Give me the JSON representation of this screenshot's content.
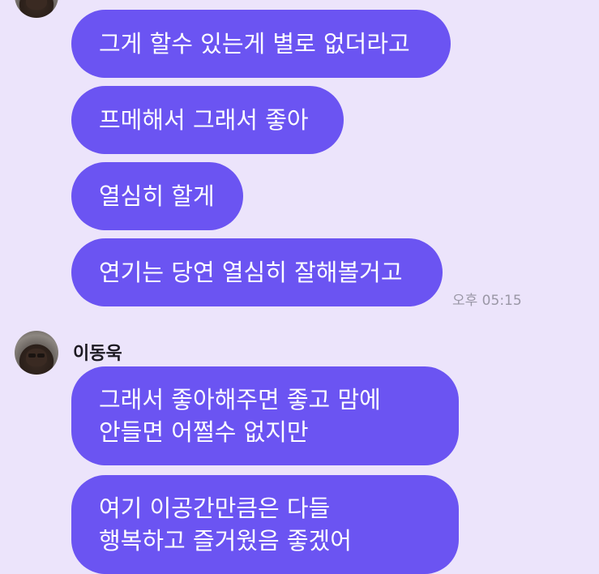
{
  "chat": {
    "messages_top": [
      "그게 할수 있는게 별로 없더라고",
      "프메해서 그래서 좋아",
      "열심히 할게",
      "연기는 당연 열심히 잘해볼거고"
    ],
    "time": "오후 05:15",
    "sender": "이동욱",
    "messages_bottom": [
      [
        "그래서 좋아해주면 좋고 맘에",
        "안들면 어쩔수 없지만"
      ],
      [
        "여기 이공간만큼은 다들",
        "행복하고 즐거웠음 좋겠어"
      ]
    ]
  },
  "colors": {
    "background": "#ece4fb",
    "bubble": "#6b54f2",
    "bubble_text": "#ffffff",
    "timestamp": "#9a97a6"
  }
}
